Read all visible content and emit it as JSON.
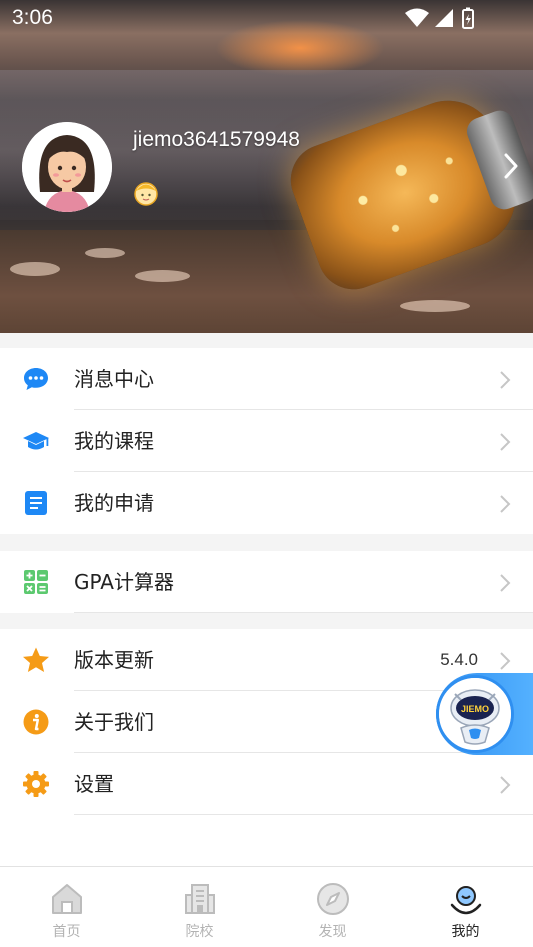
{
  "status_bar": {
    "time": "3:06"
  },
  "profile": {
    "username": "jiemo3641579948"
  },
  "menu": {
    "group1": [
      {
        "label": "消息中心",
        "icon": "message-bubble-icon"
      },
      {
        "label": "我的课程",
        "icon": "graduation-cap-icon"
      },
      {
        "label": "我的申请",
        "icon": "application-doc-icon"
      }
    ],
    "group2": [
      {
        "label": "GPA计算器",
        "icon": "calculator-icon"
      }
    ],
    "group3": [
      {
        "label": "版本更新",
        "icon": "star-icon",
        "value": "5.4.0"
      },
      {
        "label": "关于我们",
        "icon": "info-icon"
      },
      {
        "label": "设置",
        "icon": "gear-icon"
      }
    ]
  },
  "tabbar": {
    "items": [
      {
        "label": "首页",
        "icon": "home-icon",
        "active": false
      },
      {
        "label": "院校",
        "icon": "school-building-icon",
        "active": false
      },
      {
        "label": "发现",
        "icon": "compass-icon",
        "active": false
      },
      {
        "label": "我的",
        "icon": "profile-icon",
        "active": true
      }
    ]
  },
  "floating_assistant": {
    "logo_text": "JIEMO"
  },
  "colors": {
    "blue": "#1e88f5",
    "green": "#5cc96f",
    "orange": "#f59b16",
    "active_tab": "#222222",
    "inactive_tab": "#b3b3b3"
  }
}
